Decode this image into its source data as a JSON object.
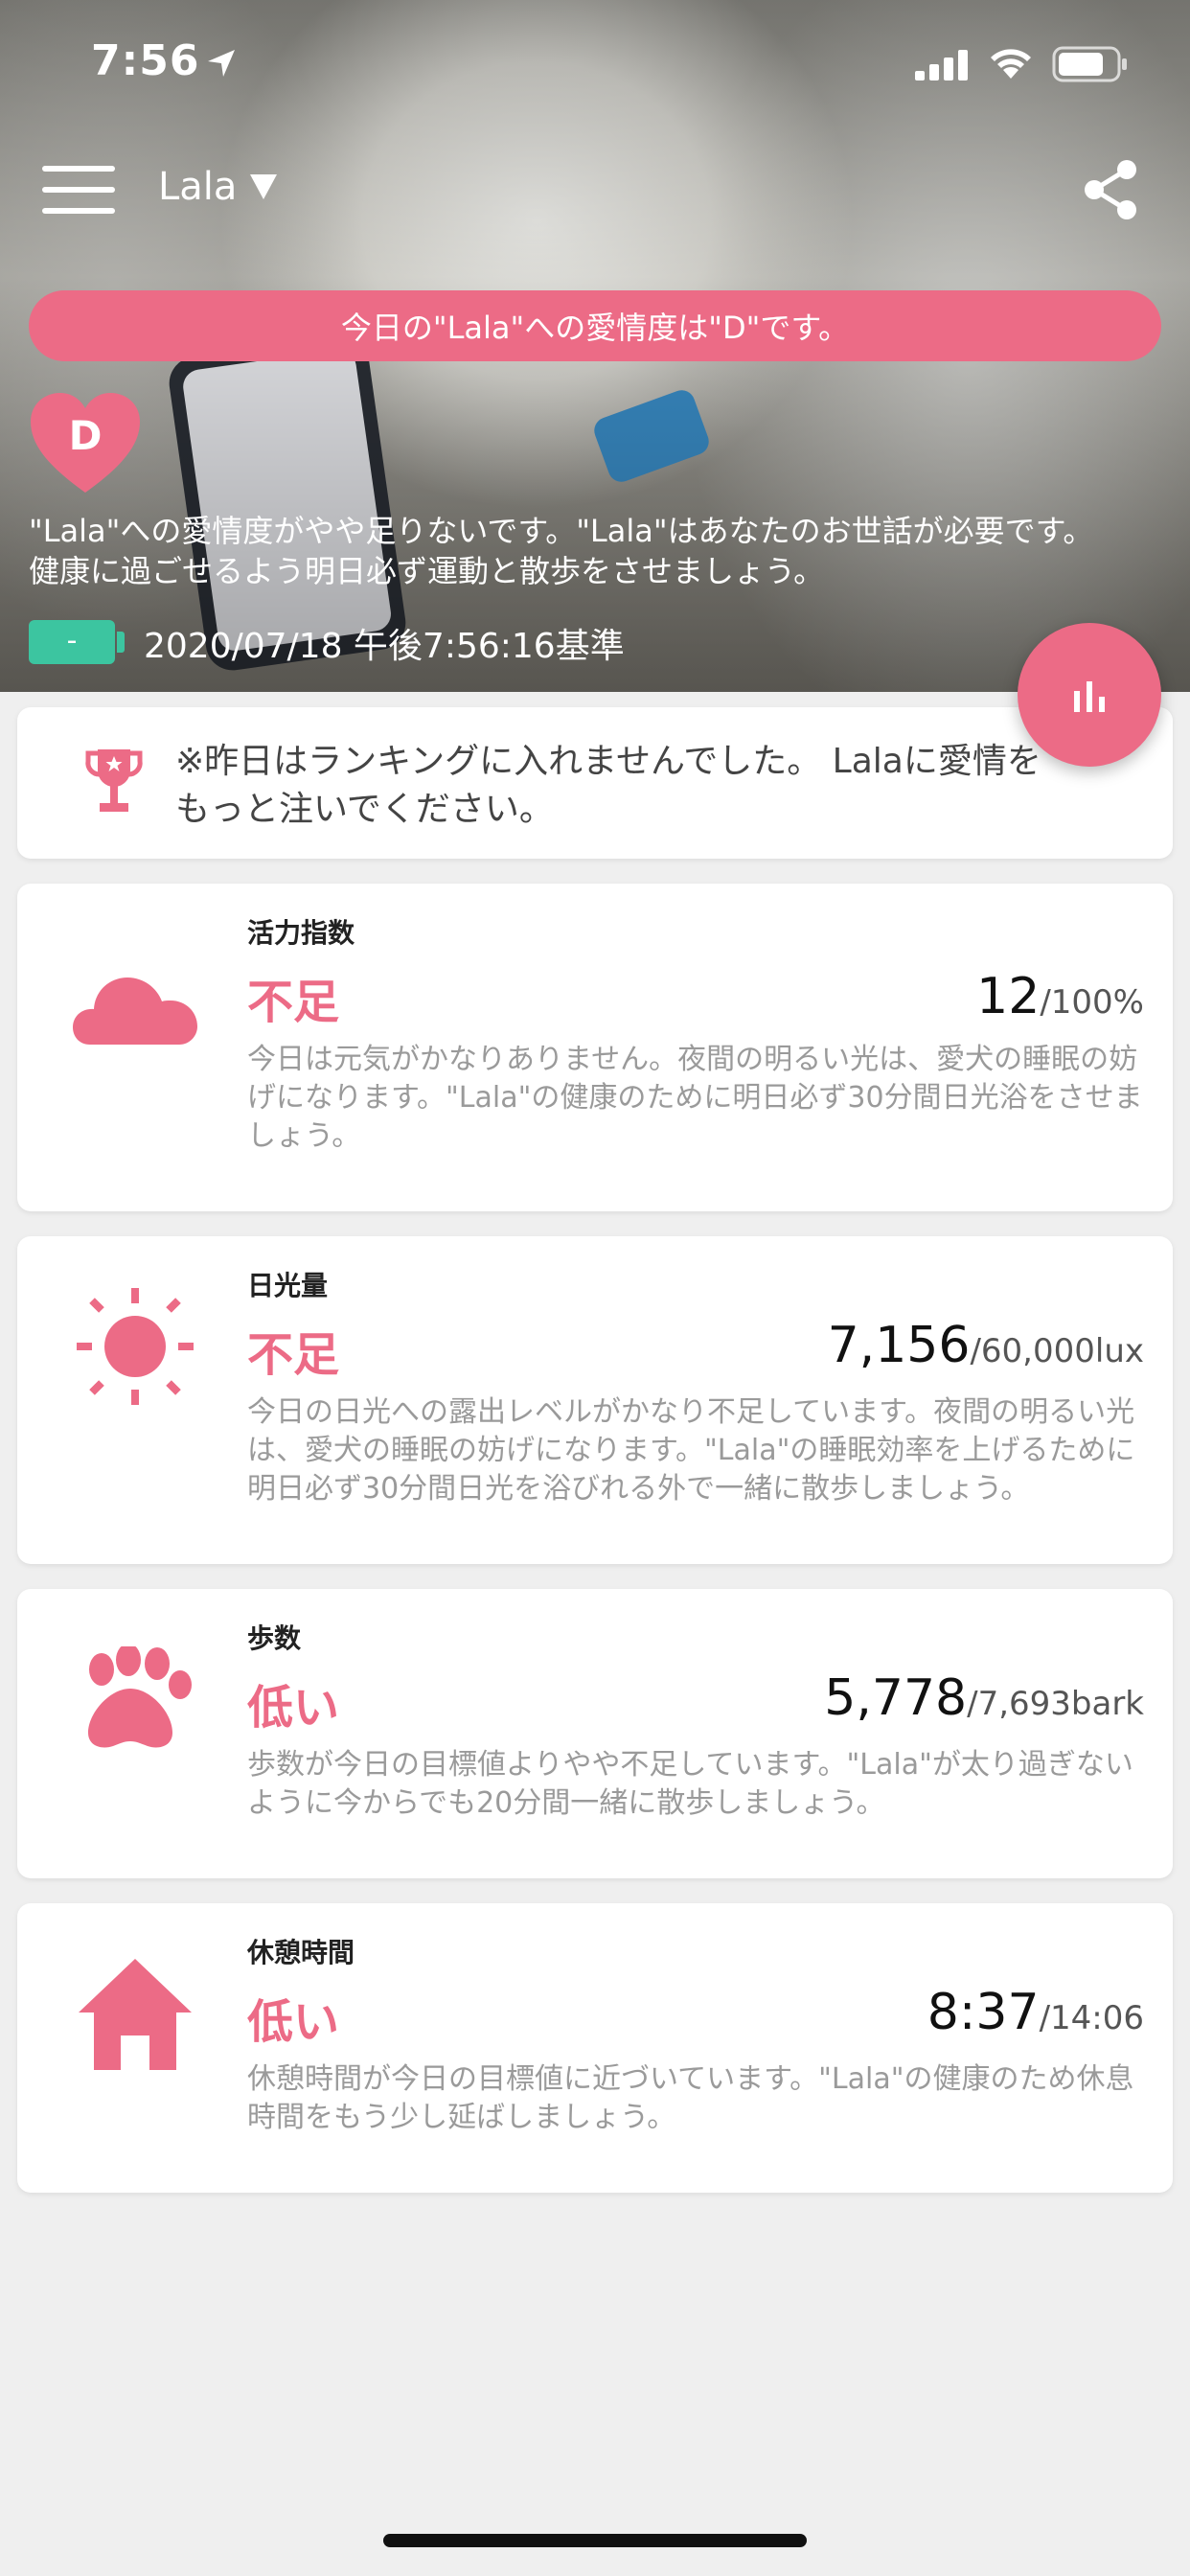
{
  "status_bar": {
    "time": "7:56"
  },
  "nav": {
    "pet_name": "Lala"
  },
  "banner": {
    "text": "今日の\"Lala\"への愛情度は\"D\"です。"
  },
  "grade": {
    "letter": "D"
  },
  "hero": {
    "message_line1": "\"Lala\"への愛情度がやや足りないです。\"Lala\"はあなたのお世話が必要です。",
    "message_line2": "健康に過ごせるよう明日必ず運動と散歩をさせましょう。",
    "battery_label": "-",
    "timestamp": "2020/07/18 午後7:56:16基準"
  },
  "ranking": {
    "text": "※昨日はランキングに入れませんでした。 Lalaに愛情をもっと注いでください。"
  },
  "metrics": [
    {
      "icon": "cloud-icon",
      "title": "活力指数",
      "status": "不足",
      "value": "12",
      "unit": "/100%",
      "description": "今日は元気がかなりありません。夜間の明るい光は、愛犬の睡眠の妨げになります。\"Lala\"の健康のために明日必ず30分間日光浴をさせましょう。"
    },
    {
      "icon": "sun-icon",
      "title": "日光量",
      "status": "不足",
      "value": "7,156",
      "unit": "/60,000lux",
      "description": "今日の日光への露出レベルがかなり不足しています。夜間の明るい光は、愛犬の睡眠の妨げになります。\"Lala\"の睡眠効率を上げるために明日必ず30分間日光を浴びれる外で一緒に散歩しましょう。"
    },
    {
      "icon": "paw-icon",
      "title": "歩数",
      "status": "低い",
      "value": "5,778",
      "unit": "/7,693bark",
      "description": "歩数が今日の目標値よりやや不足しています。\"Lala\"が太り過ぎないように今からでも20分間一緒に散歩しましょう。"
    },
    {
      "icon": "house-icon",
      "title": "休憩時間",
      "status": "低い",
      "value": "8:37",
      "unit": "/14:06",
      "description": "休憩時間が今日の目標値に近づいています。\"Lala\"の健康のため休息時間をもう少し延ばしましょう。"
    }
  ],
  "colors": {
    "accent": "#ec6b86",
    "battery": "#3cc5a0",
    "background": "#efefef"
  }
}
